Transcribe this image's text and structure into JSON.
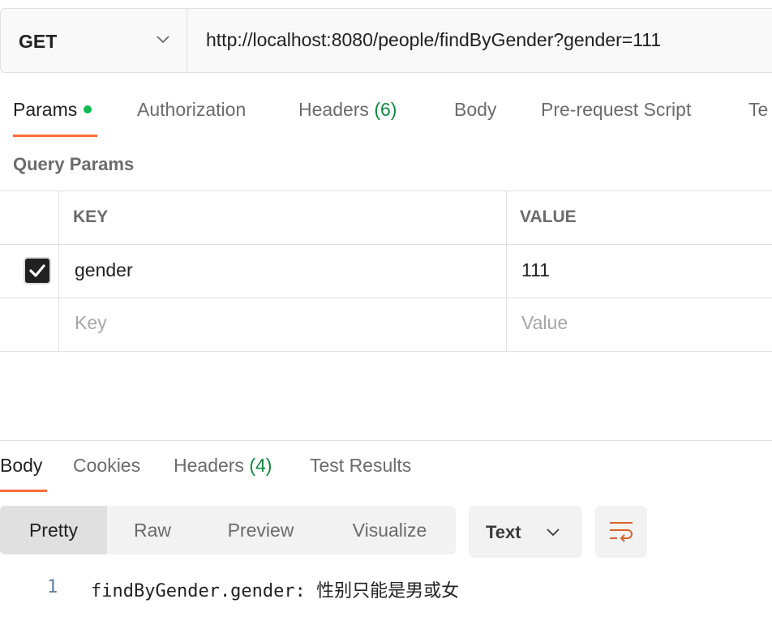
{
  "request": {
    "method": "GET",
    "url": "http://localhost:8080/people/findByGender?gender=111"
  },
  "request_tabs": {
    "params": "Params",
    "authorization": "Authorization",
    "headers": "Headers",
    "headers_count": "(6)",
    "body": "Body",
    "prerequest": "Pre-request Script",
    "tests": "Te"
  },
  "query_params": {
    "title": "Query Params",
    "columns": {
      "key": "KEY",
      "value": "VALUE"
    },
    "rows": [
      {
        "checked": true,
        "key": "gender",
        "value": "111"
      }
    ],
    "new_row": {
      "key_placeholder": "Key",
      "value_placeholder": "Value"
    }
  },
  "response_tabs": {
    "body": "Body",
    "cookies": "Cookies",
    "headers": "Headers",
    "headers_count": "(4)",
    "test_results": "Test Results"
  },
  "format": {
    "modes": [
      "Pretty",
      "Raw",
      "Preview",
      "Visualize"
    ],
    "selected_mode": "Pretty",
    "type": "Text"
  },
  "response_body": {
    "lines": [
      {
        "number": "1",
        "text": "findByGender.gender: 性别只能是男或女"
      }
    ]
  },
  "colors": {
    "accent": "#ff6c37",
    "success": "#0cbb52",
    "count": "#0f8a3e"
  }
}
